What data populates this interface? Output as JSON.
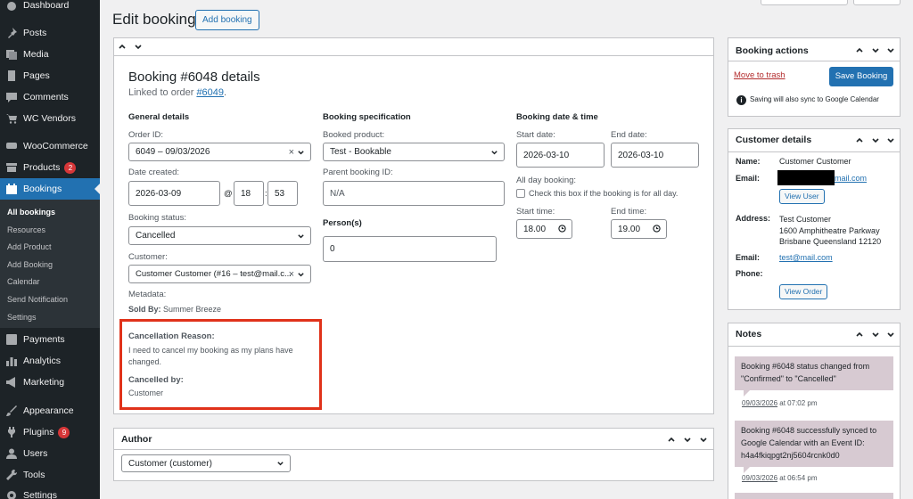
{
  "sidebar": {
    "items": [
      {
        "label": "Dashboard",
        "icon": "dashboard-icon"
      },
      {
        "label": "Posts",
        "icon": "pin-icon"
      },
      {
        "label": "Media",
        "icon": "media-icon"
      },
      {
        "label": "Pages",
        "icon": "pages-icon"
      },
      {
        "label": "Comments",
        "icon": "comments-icon"
      },
      {
        "label": "WC Vendors",
        "icon": "cart-icon"
      },
      {
        "label": "WooCommerce",
        "icon": "woo-icon"
      },
      {
        "label": "Products",
        "icon": "archive-icon",
        "badge": "2"
      },
      {
        "label": "Bookings",
        "icon": "calendar-icon"
      },
      {
        "label": "Payments",
        "icon": "dollar-icon"
      },
      {
        "label": "Analytics",
        "icon": "chart-icon"
      },
      {
        "label": "Marketing",
        "icon": "megaphone-icon"
      },
      {
        "label": "Appearance",
        "icon": "brush-icon"
      },
      {
        "label": "Plugins",
        "icon": "plug-icon",
        "badge": "9"
      },
      {
        "label": "Users",
        "icon": "user-icon"
      },
      {
        "label": "Tools",
        "icon": "wrench-icon"
      },
      {
        "label": "Settings",
        "icon": "settings-icon"
      }
    ],
    "submenu": [
      "All bookings",
      "Resources",
      "Add Product",
      "Add Booking",
      "Calendar",
      "Send Notification",
      "Settings"
    ]
  },
  "page": {
    "title": "Edit booking",
    "add_button": "Add booking"
  },
  "booking": {
    "title": "Booking #6048 details",
    "linked_prefix": "Linked to order ",
    "linked_order": "#6049",
    "linked_suffix": ".",
    "general": {
      "heading": "General details",
      "order_id_label": "Order ID:",
      "order_id_value": "6049 – 09/03/2026",
      "clear_symbol": "×",
      "date_created_label": "Date created:",
      "date_value": "2026-03-09",
      "at_symbol": "@",
      "hour": "18",
      "colon": ":",
      "minute": "53",
      "status_label": "Booking status:",
      "status_value": "Cancelled",
      "customer_label": "Customer:",
      "customer_value": "Customer Customer (#16 – test@mail.c...",
      "metadata_label": "Metadata:",
      "sold_by_label": "Sold By:",
      "sold_by_value": "Summer Breeze",
      "cancel_reason_label": "Cancellation Reason:",
      "cancel_reason_value": "I need to cancel my booking as my plans have changed.",
      "cancelled_by_label": "Cancelled by:",
      "cancelled_by_value": "Customer"
    },
    "spec": {
      "heading": "Booking specification",
      "product_label": "Booked product:",
      "product_value": "Test - Bookable",
      "parent_label": "Parent booking ID:",
      "parent_value": "N/A",
      "persons_label": "Person(s)",
      "persons_value": "0"
    },
    "datetime": {
      "heading": "Booking date & time",
      "start_date_label": "Start date:",
      "start_date": "2026-03-10",
      "end_date_label": "End date:",
      "end_date": "2026-03-10",
      "all_day_label": "All day booking:",
      "all_day_text": "Check this box if the booking is for all day.",
      "start_time_label": "Start time:",
      "start_time": "18.00",
      "end_time_label": "End time:",
      "end_time": "19.00"
    }
  },
  "author": {
    "title": "Author",
    "value": "Customer (customer)"
  },
  "actions": {
    "title": "Booking actions",
    "trash": "Move to trash",
    "save": "Save Booking",
    "info": "Saving will also sync to Google Calendar"
  },
  "customer": {
    "title": "Customer details",
    "name_label": "Name:",
    "name_value": "Customer Customer",
    "email_label": "Email:",
    "email_value": "mail.com",
    "view_user": "View User",
    "address_label": "Address:",
    "address_lines": [
      "Test Customer",
      "1600 Amphitheatre Parkway",
      "Brisbane Queensland 12120"
    ],
    "email2_label": "Email:",
    "email2_value": "test@mail.com",
    "phone_label": "Phone:",
    "view_order": "View Order"
  },
  "notes": {
    "title": "Notes",
    "items": [
      {
        "text": "Booking #6048 status changed from \"Confirmed\" to \"Cancelled\"",
        "date": "09/03/2026",
        "time": " at 07:02 pm"
      },
      {
        "text": "Booking #6048 successfully synced to Google Calendar with an Event ID: h4a4fkiqpgt2nj5604rcnk0d0",
        "date": "09/03/2026",
        "time": " at 06:54 pm"
      }
    ]
  },
  "colors": {
    "accent": "#2271b1",
    "highlight": "#e0321a",
    "trash": "#b32d2e",
    "note_bg": "#d7cad2"
  }
}
